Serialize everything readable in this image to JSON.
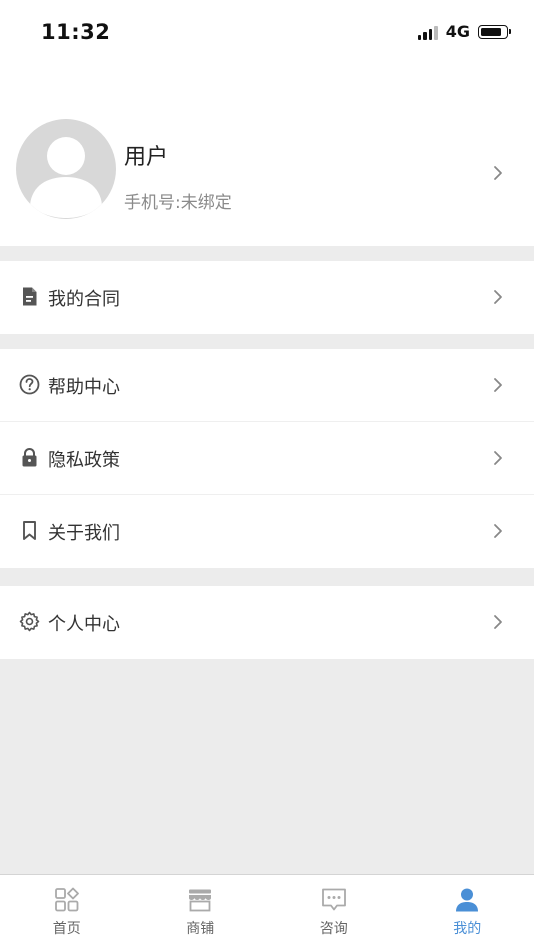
{
  "status_bar": {
    "time": "11:32",
    "network": "4G",
    "signal_icon": "cellular-signal-icon",
    "battery_icon": "battery-icon",
    "battery_level": 0.85
  },
  "profile": {
    "name": "用户",
    "phone": "手机号:未绑定",
    "avatar_icon": "default-avatar-icon",
    "chevron_icon": "chevron-right-icon"
  },
  "menu_groups": [
    {
      "items": [
        {
          "label": "我的合同",
          "icon": "document-icon"
        }
      ]
    },
    {
      "items": [
        {
          "label": "帮助中心",
          "icon": "question-circle-icon"
        },
        {
          "label": "隐私政策",
          "icon": "lock-icon"
        },
        {
          "label": "关于我们",
          "icon": "bookmark-icon"
        }
      ]
    },
    {
      "items": [
        {
          "label": "个人中心",
          "icon": "gear-icon"
        }
      ]
    }
  ],
  "tab_bar": {
    "tabs": [
      {
        "label": "首页",
        "icon": "home-grid-icon",
        "active": false
      },
      {
        "label": "商铺",
        "icon": "store-icon",
        "active": false
      },
      {
        "label": "咨询",
        "icon": "chat-icon",
        "active": false
      },
      {
        "label": "我的",
        "icon": "user-icon",
        "active": true
      }
    ]
  },
  "colors": {
    "accent": "#4a8fd6",
    "background": "#ececec",
    "icon_gray": "#555555",
    "tab_gray": "#aaaaaa"
  }
}
